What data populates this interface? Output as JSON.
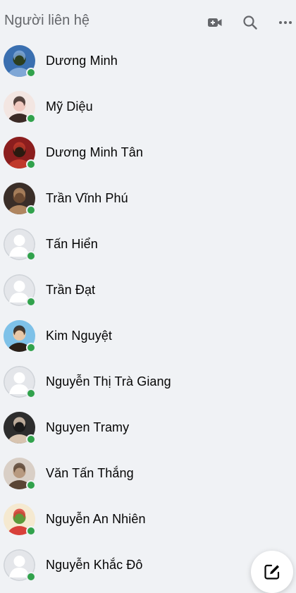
{
  "header": {
    "title": "Người liên hệ",
    "icons": [
      "video-call-icon",
      "search-icon",
      "more-icon"
    ]
  },
  "contacts": [
    {
      "name": "Dương Minh",
      "online": true,
      "avatar": "photo",
      "avatar_colors": [
        "#3a6fb0",
        "#7fa7d6",
        "#2c3e1f"
      ]
    },
    {
      "name": "Mỹ Diệu",
      "online": true,
      "avatar": "photo",
      "avatar_colors": [
        "#f3e6e2",
        "#3b2a26",
        "#f0c9c0"
      ]
    },
    {
      "name": "Dương Minh Tân",
      "online": true,
      "avatar": "photo",
      "avatar_colors": [
        "#8b1e1e",
        "#c0392b",
        "#2a1a10"
      ]
    },
    {
      "name": "Trần Vĩnh Phú",
      "online": true,
      "avatar": "photo",
      "avatar_colors": [
        "#3a2e28",
        "#b08660",
        "#6b4a32"
      ]
    },
    {
      "name": "Tấn Hiển",
      "online": true,
      "avatar": "default"
    },
    {
      "name": "Trần Đạt",
      "online": true,
      "avatar": "default"
    },
    {
      "name": "Kim Nguyệt",
      "online": true,
      "avatar": "photo",
      "avatar_colors": [
        "#7ec1e8",
        "#2b2018",
        "#e8c8a8"
      ]
    },
    {
      "name": "Nguyễn Thị Trà Giang",
      "online": true,
      "avatar": "default"
    },
    {
      "name": "Nguyen Tramy",
      "online": true,
      "avatar": "photo",
      "avatar_colors": [
        "#2d2d2d",
        "#d8c4b0",
        "#1a1a1a"
      ]
    },
    {
      "name": "Văn Tấn Thắng",
      "online": true,
      "avatar": "photo",
      "avatar_colors": [
        "#d9cfc6",
        "#5a4535",
        "#b89a80"
      ]
    },
    {
      "name": "Nguyễn An Nhiên",
      "online": true,
      "avatar": "photo",
      "avatar_colors": [
        "#f5e9d0",
        "#d8403a",
        "#5c9a3a"
      ]
    },
    {
      "name": "Nguyễn Khắc Đô",
      "online": true,
      "avatar": "default"
    }
  ],
  "compose": {
    "icon": "compose-icon"
  },
  "colors": {
    "online": "#31a24c",
    "background": "#f0f2f5",
    "header_text": "#65676b",
    "icon": "#65676b"
  }
}
